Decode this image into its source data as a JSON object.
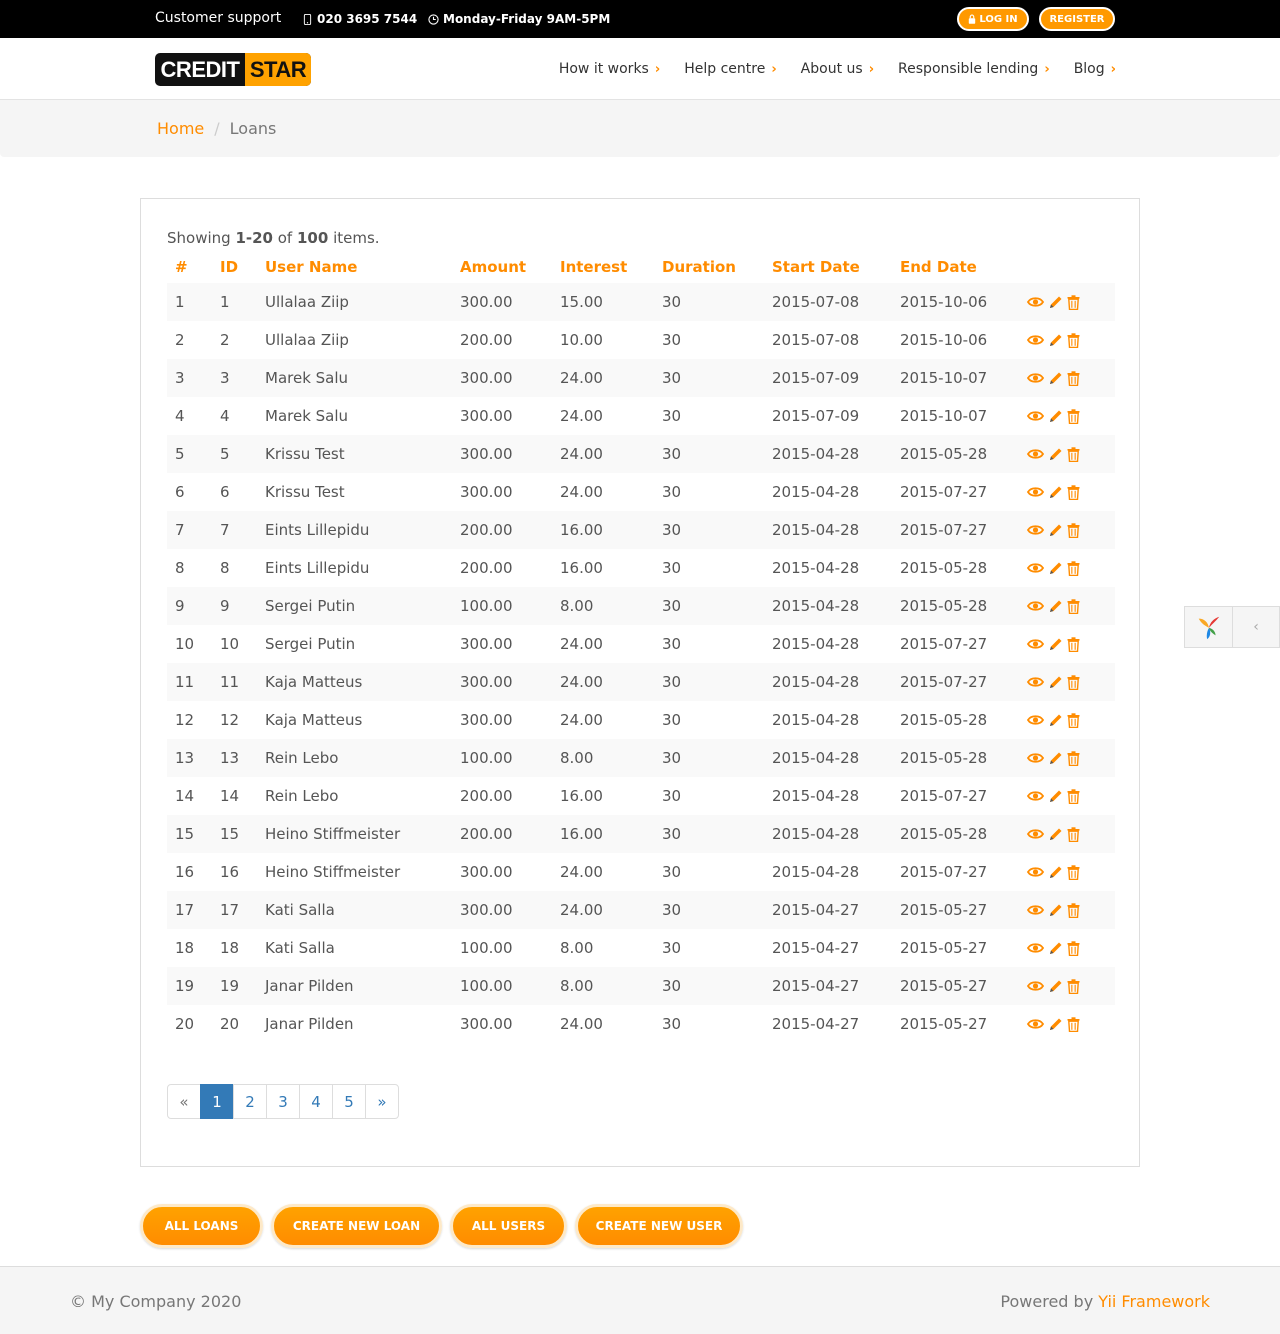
{
  "topbar": {
    "support_label": "Customer support",
    "phone": "020 3695 7544",
    "hours": "Monday-Friday 9AM-5PM",
    "login_label": "LOG IN",
    "register_label": "REGISTER"
  },
  "header": {
    "logo_part1": "CREDIT",
    "logo_part2": "STAR",
    "nav": [
      {
        "label": "How it works",
        "chevron": "›"
      },
      {
        "label": "Help centre",
        "chevron": "›"
      },
      {
        "label": "About us",
        "chevron": "›"
      },
      {
        "label": "Responsible lending",
        "chevron": "›"
      },
      {
        "label": "Blog",
        "chevron": "›"
      }
    ]
  },
  "breadcrumb": {
    "home": "Home",
    "separator": "/",
    "current": "Loans"
  },
  "summary": {
    "prefix": "Showing ",
    "range": "1-20",
    "middle": " of ",
    "total": "100",
    "suffix": " items."
  },
  "table": {
    "headers": [
      "#",
      "ID",
      "User Name",
      "Amount",
      "Interest",
      "Duration",
      "Start Date",
      "End Date"
    ],
    "rows": [
      [
        "1",
        "1",
        "Ullalaa Ziip",
        "300.00",
        "15.00",
        "30",
        "2015-07-08",
        "2015-10-06"
      ],
      [
        "2",
        "2",
        "Ullalaa Ziip",
        "200.00",
        "10.00",
        "30",
        "2015-07-08",
        "2015-10-06"
      ],
      [
        "3",
        "3",
        "Marek Salu",
        "300.00",
        "24.00",
        "30",
        "2015-07-09",
        "2015-10-07"
      ],
      [
        "4",
        "4",
        "Marek Salu",
        "300.00",
        "24.00",
        "30",
        "2015-07-09",
        "2015-10-07"
      ],
      [
        "5",
        "5",
        "Krissu Test",
        "300.00",
        "24.00",
        "30",
        "2015-04-28",
        "2015-05-28"
      ],
      [
        "6",
        "6",
        "Krissu Test",
        "300.00",
        "24.00",
        "30",
        "2015-04-28",
        "2015-07-27"
      ],
      [
        "7",
        "7",
        "Eints Lillepidu",
        "200.00",
        "16.00",
        "30",
        "2015-04-28",
        "2015-07-27"
      ],
      [
        "8",
        "8",
        "Eints Lillepidu",
        "200.00",
        "16.00",
        "30",
        "2015-04-28",
        "2015-05-28"
      ],
      [
        "9",
        "9",
        "Sergei Putin",
        "100.00",
        "8.00",
        "30",
        "2015-04-28",
        "2015-05-28"
      ],
      [
        "10",
        "10",
        "Sergei Putin",
        "300.00",
        "24.00",
        "30",
        "2015-04-28",
        "2015-07-27"
      ],
      [
        "11",
        "11",
        "Kaja Matteus",
        "300.00",
        "24.00",
        "30",
        "2015-04-28",
        "2015-07-27"
      ],
      [
        "12",
        "12",
        "Kaja Matteus",
        "300.00",
        "24.00",
        "30",
        "2015-04-28",
        "2015-05-28"
      ],
      [
        "13",
        "13",
        "Rein Lebo",
        "100.00",
        "8.00",
        "30",
        "2015-04-28",
        "2015-05-28"
      ],
      [
        "14",
        "14",
        "Rein Lebo",
        "200.00",
        "16.00",
        "30",
        "2015-04-28",
        "2015-07-27"
      ],
      [
        "15",
        "15",
        "Heino Stiffmeister",
        "200.00",
        "16.00",
        "30",
        "2015-04-28",
        "2015-05-28"
      ],
      [
        "16",
        "16",
        "Heino Stiffmeister",
        "300.00",
        "24.00",
        "30",
        "2015-04-28",
        "2015-07-27"
      ],
      [
        "17",
        "17",
        "Kati Salla",
        "300.00",
        "24.00",
        "30",
        "2015-04-27",
        "2015-05-27"
      ],
      [
        "18",
        "18",
        "Kati Salla",
        "100.00",
        "8.00",
        "30",
        "2015-04-27",
        "2015-05-27"
      ],
      [
        "19",
        "19",
        "Janar Pilden",
        "100.00",
        "8.00",
        "30",
        "2015-04-27",
        "2015-05-27"
      ],
      [
        "20",
        "20",
        "Janar Pilden",
        "300.00",
        "24.00",
        "30",
        "2015-04-27",
        "2015-05-27"
      ]
    ],
    "row_action_icons": [
      "eye-icon",
      "pencil-icon",
      "trash-icon"
    ]
  },
  "pagination": {
    "prev": "«",
    "pages": [
      "1",
      "2",
      "3",
      "4",
      "5"
    ],
    "active": "1",
    "next": "»"
  },
  "buttons": {
    "all_loans": "ALL LOANS",
    "create_loan": "CREATE NEW LOAN",
    "all_users": "ALL USERS",
    "create_user": "CREATE NEW USER"
  },
  "debug_toggle": {
    "arrow": "‹"
  },
  "footer": {
    "copyright": "© My Company 2020",
    "powered_prefix": "Powered by ",
    "powered_link": "Yii Framework"
  },
  "colors": {
    "accent": "#ff8c00",
    "pagination_active": "#337ab7",
    "topbar": "#000000"
  }
}
